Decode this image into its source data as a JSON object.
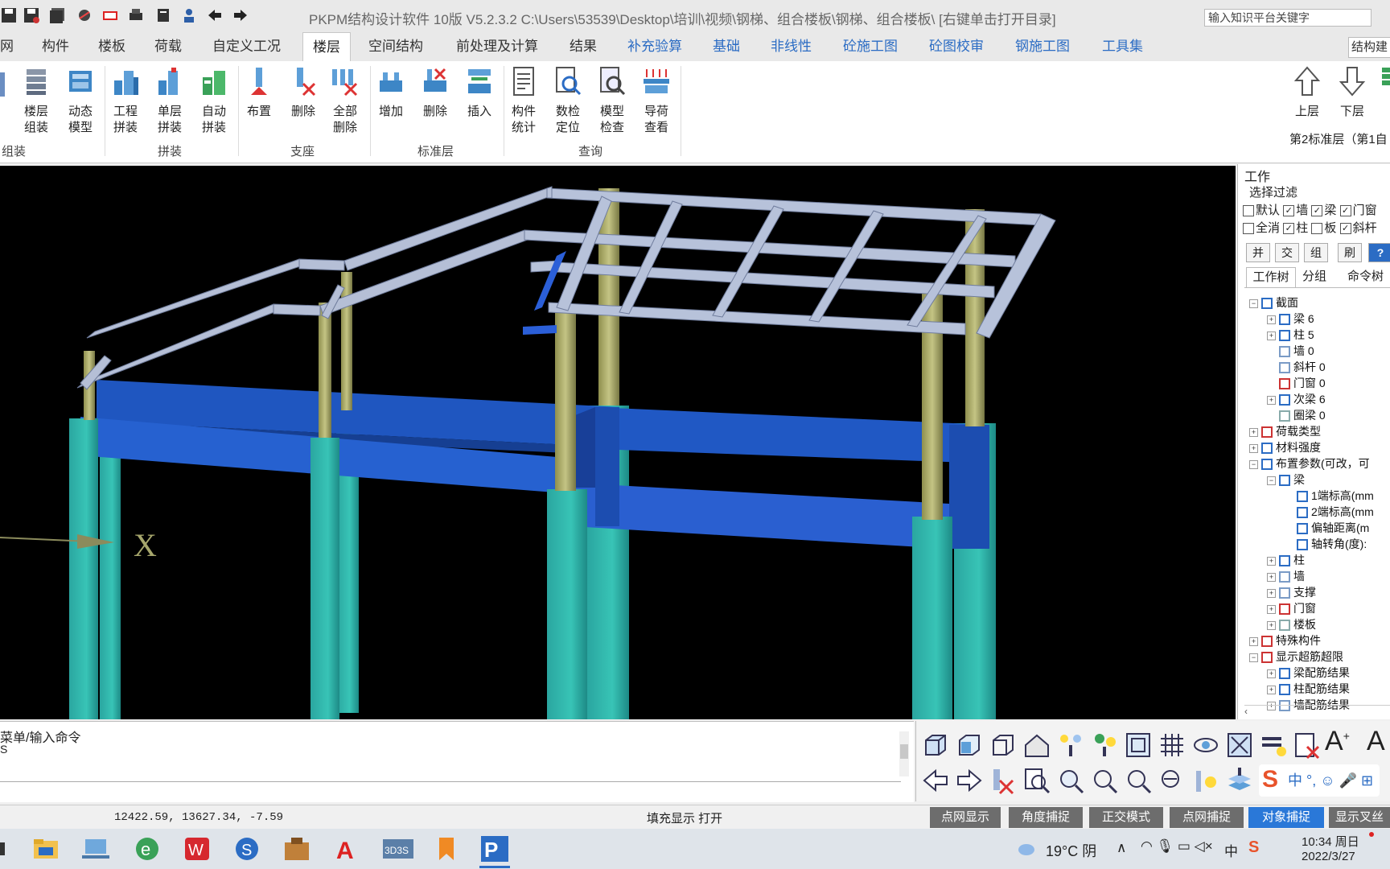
{
  "window": {
    "title": "PKPM结构设计软件 10版 V5.2.3.2 C:\\Users\\53539\\Desktop\\培训\\视频\\钢梯、组合楼板\\钢梯、组合楼板\\ [右键单击打开目录]",
    "search_placeholder": "输入知识平台关键字"
  },
  "tabs": [
    {
      "label": "网",
      "style": "normal"
    },
    {
      "label": "构件",
      "style": "normal"
    },
    {
      "label": "楼板",
      "style": "normal"
    },
    {
      "label": "荷载",
      "style": "normal"
    },
    {
      "label": "自定义工况",
      "style": "normal"
    },
    {
      "label": "楼层",
      "style": "active"
    },
    {
      "label": "空间结构",
      "style": "normal"
    },
    {
      "label": "前处理及计算",
      "style": "normal"
    },
    {
      "label": "结果",
      "style": "normal"
    },
    {
      "label": "补充验算",
      "style": "blue"
    },
    {
      "label": "基础",
      "style": "blue"
    },
    {
      "label": "非线性",
      "style": "blue"
    },
    {
      "label": "砼施工图",
      "style": "blue"
    },
    {
      "label": "砼图校审",
      "style": "blue"
    },
    {
      "label": "钢施工图",
      "style": "blue"
    },
    {
      "label": "工具集",
      "style": "blue"
    },
    {
      "label": "结构建",
      "style": "normal"
    }
  ],
  "ribbon": {
    "buttons": [
      {
        "line1": "楼层",
        "line2": "组装",
        "icon": "floor-assembly-icon"
      },
      {
        "line1": "动态",
        "line2": "模型",
        "icon": "dynamic-model-icon"
      },
      {
        "line1": "工程",
        "line2": "拼装",
        "icon": "project-assembly-icon"
      },
      {
        "line1": "单层",
        "line2": "拼装",
        "icon": "single-floor-assembly-icon"
      },
      {
        "line1": "自动",
        "line2": "拼装",
        "icon": "auto-assembly-icon"
      },
      {
        "line1": "布置",
        "line2": "",
        "icon": "support-place-icon"
      },
      {
        "line1": "删除",
        "line2": "",
        "icon": "support-delete-icon"
      },
      {
        "line1": "全部",
        "line2": "删除",
        "icon": "delete-all-icon"
      },
      {
        "line1": "增加",
        "line2": "",
        "icon": "add-floor-icon"
      },
      {
        "line1": "删除",
        "line2": "",
        "icon": "delete-floor-icon"
      },
      {
        "line1": "插入",
        "line2": "",
        "icon": "insert-floor-icon"
      },
      {
        "line1": "构件",
        "line2": "统计",
        "icon": "member-stats-icon"
      },
      {
        "line1": "数检",
        "line2": "定位",
        "icon": "data-check-icon"
      },
      {
        "line1": "模型",
        "line2": "检查",
        "icon": "model-check-icon"
      },
      {
        "line1": "导荷",
        "line2": "查看",
        "icon": "load-transfer-icon"
      }
    ],
    "groups": [
      "组装",
      "拼装",
      "支座",
      "标准层",
      "查询"
    ],
    "floor_nav": {
      "up": "上层",
      "down": "下层",
      "current": "第2标准层（第1自"
    }
  },
  "panel": {
    "title": "工作",
    "filter_label": "选择过滤",
    "filter_row1": [
      {
        "label": "默认",
        "checked": false
      },
      {
        "label": "墙",
        "checked": true
      },
      {
        "label": "梁",
        "checked": true
      },
      {
        "label": "门窗",
        "checked": true
      }
    ],
    "filter_row2": [
      {
        "label": "全消",
        "checked": false
      },
      {
        "label": "柱",
        "checked": true
      },
      {
        "label": "板",
        "checked": false
      },
      {
        "label": "斜杆",
        "checked": true
      }
    ],
    "buttons": [
      "并",
      "交",
      "组",
      "刷",
      "?"
    ],
    "tabs": [
      "工作树",
      "分组",
      "命令树"
    ],
    "tree": [
      {
        "indent": 0,
        "exp": "-",
        "icon": "section-icon",
        "label": "截面"
      },
      {
        "indent": 1,
        "exp": "+",
        "icon": "beam-icon",
        "label": "梁 6"
      },
      {
        "indent": 1,
        "exp": "+",
        "icon": "column-icon",
        "label": "柱 5"
      },
      {
        "indent": 1,
        "exp": "",
        "icon": "wall-icon",
        "label": "墙 0"
      },
      {
        "indent": 1,
        "exp": "",
        "icon": "brace-icon",
        "label": "斜杆 0"
      },
      {
        "indent": 1,
        "exp": "",
        "icon": "door-window-icon",
        "label": "门窗 0"
      },
      {
        "indent": 1,
        "exp": "+",
        "icon": "secondary-beam-icon",
        "label": "次梁 6"
      },
      {
        "indent": 1,
        "exp": "",
        "icon": "ring-beam-icon",
        "label": "圈梁 0"
      },
      {
        "indent": 0,
        "exp": "+",
        "icon": "load-type-icon",
        "label": "荷载类型"
      },
      {
        "indent": 0,
        "exp": "+",
        "icon": "material-icon",
        "label": "材料强度"
      },
      {
        "indent": 0,
        "exp": "-",
        "icon": "layout-param-icon",
        "label": "布置参数(可改，可"
      },
      {
        "indent": 1,
        "exp": "-",
        "icon": "beam-icon",
        "label": "梁"
      },
      {
        "indent": 2,
        "exp": "",
        "icon": "z1-icon",
        "label": "1端标高(mm"
      },
      {
        "indent": 2,
        "exp": "",
        "icon": "z2-icon",
        "label": "2端标高(mm"
      },
      {
        "indent": 2,
        "exp": "",
        "icon": "ec-icon",
        "label": "偏轴距离(m"
      },
      {
        "indent": 2,
        "exp": "",
        "icon": "a-icon",
        "label": "轴转角(度):"
      },
      {
        "indent": 1,
        "exp": "+",
        "icon": "column-icon",
        "label": "柱"
      },
      {
        "indent": 1,
        "exp": "+",
        "icon": "wall-icon",
        "label": "墙"
      },
      {
        "indent": 1,
        "exp": "+",
        "icon": "brace-icon",
        "label": "支撑"
      },
      {
        "indent": 1,
        "exp": "+",
        "icon": "door-window-icon",
        "label": "门窗"
      },
      {
        "indent": 1,
        "exp": "+",
        "icon": "slab-icon",
        "label": "楼板"
      },
      {
        "indent": 0,
        "exp": "+",
        "icon": "special-member-icon",
        "label": "特殊构件"
      },
      {
        "indent": 0,
        "exp": "-",
        "icon": "r-icon",
        "label": "显示超筋超限"
      },
      {
        "indent": 1,
        "exp": "+",
        "icon": "beam-icon",
        "label": "梁配筋结果"
      },
      {
        "indent": 1,
        "exp": "+",
        "icon": "column-icon",
        "label": "柱配筋结果"
      },
      {
        "indent": 1,
        "exp": "+",
        "icon": "wall-icon",
        "label": "墙配筋结果"
      }
    ]
  },
  "viewport": {
    "axis_label": "X"
  },
  "command": {
    "prompt": "菜单/输入命令",
    "history": "S"
  },
  "status": {
    "coords": "12422.59, 13627.34, -7.59",
    "fill_display": "填充显示 打开",
    "toggles": [
      {
        "label": "点网显示",
        "on": false
      },
      {
        "label": "角度捕捉",
        "on": false
      },
      {
        "label": "正交模式",
        "on": false
      },
      {
        "label": "点网捕捉",
        "on": false
      },
      {
        "label": "对象捕捉",
        "on": true
      },
      {
        "label": "显示叉丝",
        "on": false
      }
    ]
  },
  "taskbar": {
    "weather": "19°C 阴",
    "time": "10:34 周日",
    "date": "2022/3/27",
    "ime": "中",
    "apps": [
      "file-explorer-icon",
      "computer-icon",
      "browser-icon",
      "wps-icon",
      "sogou-icon",
      "toolbox-icon",
      "autocad-icon",
      "3d3s-icon",
      "bookmark-app-icon",
      "pkpm-icon"
    ]
  }
}
